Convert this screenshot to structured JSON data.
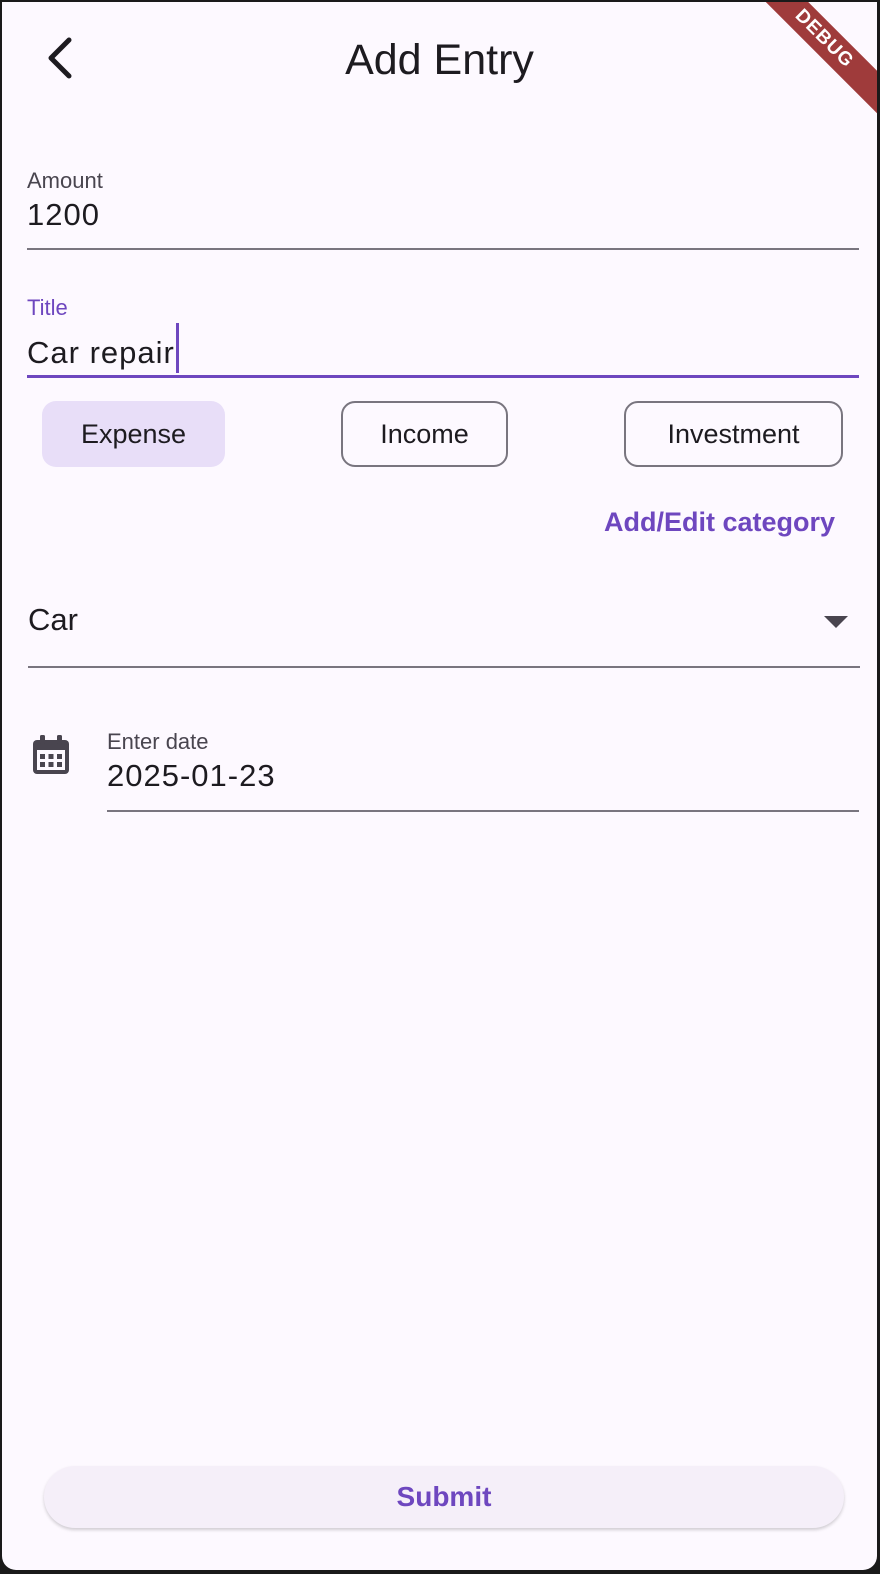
{
  "app_bar": {
    "title": "Add Entry",
    "back_icon": "chevron-left-icon"
  },
  "debug_banner": "DEBUG",
  "form": {
    "amount": {
      "label": "Amount",
      "value": "1200"
    },
    "title": {
      "label": "Title",
      "value": "Car repair",
      "focused": true
    },
    "type_options": [
      {
        "label": "Expense",
        "selected": true
      },
      {
        "label": "Income",
        "selected": false
      },
      {
        "label": "Investment",
        "selected": false
      }
    ],
    "edit_category_label": "Add/Edit category",
    "category": {
      "selected": "Car",
      "arrow_icon": "caret-down-icon"
    },
    "date": {
      "label": "Enter date",
      "value": "2025-01-23",
      "icon": "calendar-icon"
    },
    "submit_label": "Submit"
  },
  "colors": {
    "accent": "#6e47bf",
    "background": "#fdf9ff",
    "selected_chip": "#e8def8",
    "debug_banner": "#9f3b3b"
  }
}
